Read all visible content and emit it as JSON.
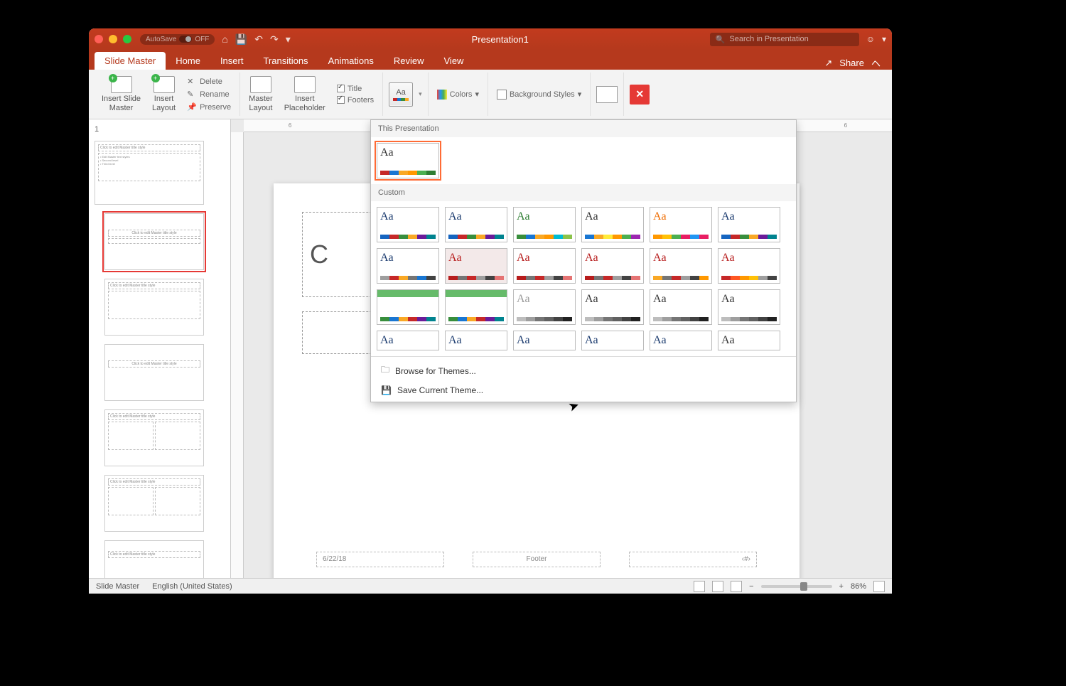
{
  "titlebar": {
    "autosave_label": "AutoSave",
    "autosave_state": "OFF",
    "doc_title": "Presentation1",
    "search_placeholder": "Search in Presentation"
  },
  "tabs": {
    "slide_master": "Slide Master",
    "home": "Home",
    "insert": "Insert",
    "transitions": "Transitions",
    "animations": "Animations",
    "review": "Review",
    "view": "View",
    "share": "Share"
  },
  "ribbon": {
    "insert_slide_master": "Insert Slide\nMaster",
    "insert_layout": "Insert\nLayout",
    "delete": "Delete",
    "rename": "Rename",
    "preserve": "Preserve",
    "master_layout": "Master\nLayout",
    "insert_placeholder": "Insert\nPlaceholder",
    "title_chk": "Title",
    "footers_chk": "Footers",
    "colors": "Colors",
    "background_styles": "Background Styles"
  },
  "dropdown": {
    "section_this": "This Presentation",
    "section_custom": "Custom",
    "browse": "Browse for Themes...",
    "save": "Save Current Theme..."
  },
  "thumbnails": {
    "num1": "1",
    "master_title": "Click to edit Master title style",
    "master_body": "• Edit Master text styles\n  • Second level\n    • Third level",
    "layout_title": "Click to edit Master title style"
  },
  "canvas": {
    "title_text": "C",
    "footer_date": "6/22/18",
    "footer_center": "Footer",
    "footer_page": "‹#›"
  },
  "status": {
    "view_mode": "Slide Master",
    "language": "English (United States)",
    "zoom": "86%"
  }
}
